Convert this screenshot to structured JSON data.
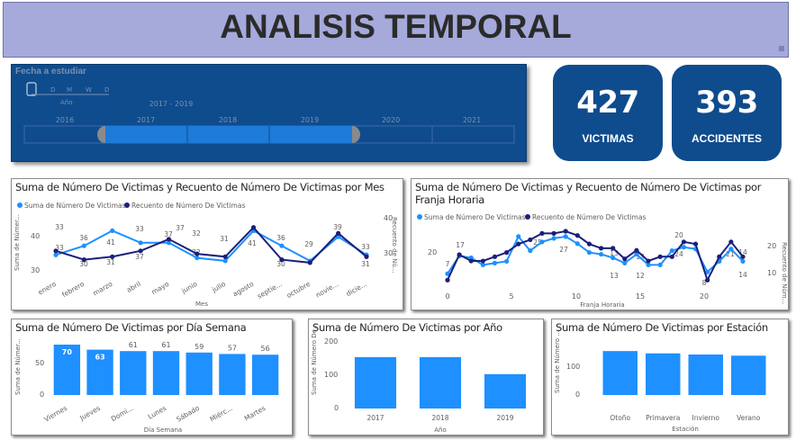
{
  "header": {
    "title": "ANALISIS TEMPORAL"
  },
  "slicer": {
    "title": "Fecha a estudiar",
    "levels": [
      "D",
      "M",
      "W",
      "D"
    ],
    "level_label": "Año",
    "range_label": "2017 - 2019",
    "years": [
      "2016",
      "2017",
      "2018",
      "2019",
      "2020",
      "2021"
    ]
  },
  "cards": [
    {
      "value": "427",
      "label": "VICTIMAS"
    },
    {
      "value": "393",
      "label": "ACCIDENTES"
    }
  ],
  "colors": {
    "series1": "#1e90ff",
    "series2": "#1a1f7a",
    "bar": "#1e90ff",
    "dark_blue": "#0f4c8d"
  },
  "chart_data": [
    {
      "id": "mes",
      "type": "line",
      "title": "Suma de Número De Victimas y Recuento de Número De Victimas por Mes",
      "xlabel": "Mes",
      "ylabel_left": "Suma de Númer...",
      "ylabel_right": "Recuento de Nú...",
      "categories": [
        "enero",
        "febrero",
        "marzo",
        "abril",
        "mayo",
        "junio",
        "julio",
        "agosto",
        "septie...",
        "octubre",
        "novie...",
        "dicie..."
      ],
      "left_ticks": [
        "40",
        "30"
      ],
      "right_ticks": [
        "40",
        "30"
      ],
      "ylim_left": [
        28,
        45
      ],
      "ylim_right": [
        26.5,
        44
      ],
      "series": [
        {
          "name": "Suma de Número De Victimas",
          "values": [
            33,
            36,
            41,
            37,
            37,
            32,
            31,
            41,
            36,
            31,
            39,
            33
          ]
        },
        {
          "name": "Recuento de Número De Victimas",
          "values": [
            33,
            30,
            31,
            33,
            37,
            32,
            31,
            41,
            30,
            29,
            39,
            31
          ]
        }
      ],
      "labels": [
        "33",
        "36",
        "30",
        "41",
        "31",
        "33",
        "37",
        "37",
        "37",
        "32",
        "32",
        "31",
        "41",
        "36",
        "30",
        "29",
        "39",
        "33",
        "31"
      ]
    },
    {
      "id": "franja",
      "type": "line",
      "title": "Suma de Número De Victimas y Recuento de Número De Victimas por Franja Horaria",
      "xlabel": "Franja Horaria",
      "ylabel_right": "Recuento de Núm...",
      "x_ticks": [
        "0",
        "5",
        "10",
        "15",
        "20"
      ],
      "left_ticks": [
        "20"
      ],
      "right_ticks": [
        "20",
        "10"
      ],
      "ylim_left": [
        1,
        31
      ],
      "ylim_right": [
        1,
        26
      ],
      "series": [
        {
          "name": "Suma de Número De Victimas",
          "values": [
            7,
            17,
            16,
            12,
            13,
            14,
            28,
            20,
            25,
            27,
            28,
            24,
            19,
            18,
            16,
            13,
            18,
            12,
            12,
            20,
            22,
            21,
            8,
            14,
            21,
            14
          ]
        },
        {
          "name": "Recuento de Número De Victimas",
          "values": [
            3,
            15,
            12,
            12,
            14,
            16,
            20,
            22,
            25,
            25,
            26,
            24,
            20,
            18,
            18,
            13,
            17,
            12,
            14,
            14,
            21,
            20,
            3,
            14,
            21,
            14
          ]
        }
      ],
      "labels": [
        "7",
        "17",
        "25",
        "27",
        "13",
        "13",
        "12",
        "12",
        "24",
        "20",
        "21",
        "14",
        "14",
        "8"
      ]
    },
    {
      "id": "dia",
      "type": "bar",
      "title": "Suma de Número De Victimas por Día Semana",
      "xlabel": "Día Semana",
      "ylabel": "Suma de Númer...",
      "y_ticks": [
        "50",
        "0"
      ],
      "ylim": [
        0,
        80
      ],
      "categories": [
        "Viernes",
        "Jueves",
        "Domi...",
        "Lunes",
        "Sábado",
        "Miérc...",
        "Martes"
      ],
      "values": [
        70,
        63,
        61,
        61,
        59,
        57,
        56
      ],
      "value_labels": [
        "70",
        "63",
        "61",
        "61",
        "59",
        "57",
        "56"
      ]
    },
    {
      "id": "anio",
      "type": "bar",
      "title": "Suma de Número De Victimas por Año",
      "xlabel": "Año",
      "ylabel": "Suma de Número De...",
      "y_ticks": [
        "200",
        "100",
        "0"
      ],
      "ylim": [
        0,
        210
      ],
      "categories": [
        "2017",
        "2018",
        "2019"
      ],
      "values": [
        160,
        160,
        107
      ]
    },
    {
      "id": "estacion",
      "type": "bar",
      "title": "Suma de Número De Victimas por Estación",
      "xlabel": "Estación",
      "ylabel": "Suma de Número ...",
      "y_ticks": [
        "100",
        "0"
      ],
      "ylim": [
        0,
        140
      ],
      "categories": [
        "Otoño",
        "Primavera",
        "Invierno",
        "Verano"
      ],
      "values": [
        114,
        108,
        105,
        102
      ]
    }
  ]
}
